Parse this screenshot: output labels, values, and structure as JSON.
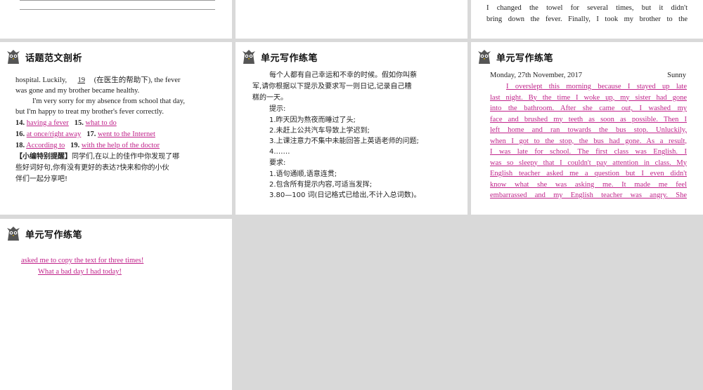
{
  "panel_top_right": {
    "lines": [
      "I changed the towel for several times, but it didn't",
      "bring down the fever. Finally, I took my brother to the"
    ]
  },
  "panel_mid_left": {
    "header": "话题范文剖析",
    "para1_a": "hospital. Luckily, ",
    "blank19": "19",
    "para1_b": "(在医生的帮助下), the fever",
    "para1_c": "was gone and my brother became healthy.",
    "para2_a": "I'm very sorry for my absence from school that day,",
    "para2_b": "but I'm happy to treat my brother's fever correctly.",
    "ans14_num": "14.",
    "ans14": "having a fever",
    "ans15_num": "15.",
    "ans15": "what to do",
    "ans16_num": "16.",
    "ans16": "at once/right away",
    "ans17_num": "17.",
    "ans17": "went to the Internet",
    "ans18_num": "18.",
    "ans18": "According to",
    "ans19_num": "19.",
    "ans19": "with the help of the doctor",
    "tip_label": "【小编特别提醒】",
    "tip_text1": "同学们,在以上的佳作中你发现了哪",
    "tip_text2": "些好词好句,你有没有更好的表达?快来和你的小伙",
    "tip_text3": "伴们一起分享吧!"
  },
  "panel_mid_center": {
    "header": "单元写作练笔",
    "intro1": "每个人都有自己幸运和不幸的时候。假如你叫蔡",
    "intro2": "军,请你根据以下提示及要求写一则日记,记录自己糟",
    "intro3": "糕的一天。",
    "hint_label": "提示:",
    "hints": [
      "1.昨天因为熬夜而睡过了头;",
      "2.未赶上公共汽车导致上学迟到;",
      "3.上课注意力不集中未能回答上英语老师的问题;",
      "4.……"
    ],
    "req_label": "要求:",
    "reqs": [
      "1.语句通顺,语意连贯;",
      "2.包含所有提示内容,可适当发挥;",
      "3.80—100 词(日记格式已给出,不计入总词数)。"
    ]
  },
  "panel_mid_right": {
    "header": "单元写作练笔",
    "date": "Monday, 27th November, 2017",
    "weather": "Sunny",
    "lines": [
      "I overslept this morning because I stayed up late",
      "last night. By the time I woke up, my sister had gone",
      "into the bathroom. After she came out, I washed my",
      "face and brushed my teeth as soon as possible. Then I",
      "left home and ran towards the bus stop. Unluckily,",
      "when I got to the stop, the bus had gone. As a result,",
      "I was late for school. The first class was English. I",
      "was so sleepy that I couldn't pay attention in class. My",
      "English teacher asked me a question but I even didn't",
      "know what she was asking me. It made me feel",
      "embarrassed and my English teacher was angry. She"
    ]
  },
  "panel_bottom_left": {
    "header": "单元写作练笔",
    "line1": "asked me to copy the text for three times!",
    "line2": "What a bad day I had today!"
  },
  "colors": {
    "answer": "#c0228a",
    "background": "#d9d9d9",
    "panel": "#ffffff"
  },
  "icons": {
    "header_mascot": "owl-mascot-icon"
  }
}
